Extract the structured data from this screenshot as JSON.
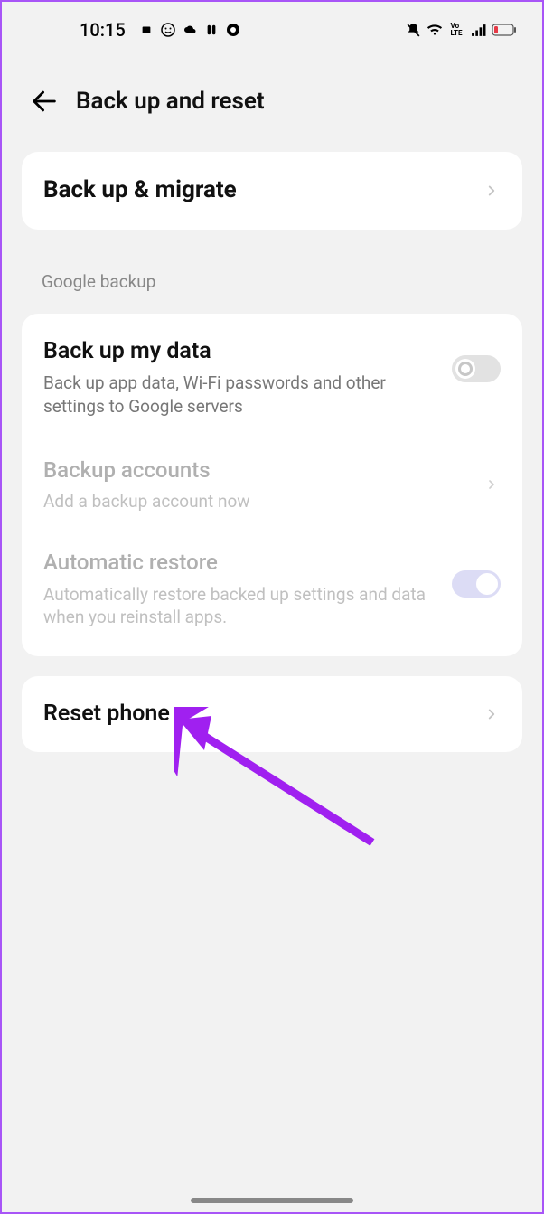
{
  "status_bar": {
    "time": "10:15"
  },
  "header": {
    "title": "Back up and reset"
  },
  "backup_migrate": {
    "label": "Back up & migrate"
  },
  "section_label": "Google backup",
  "backup_my_data": {
    "title": "Back up my data",
    "sub": "Back up app data, Wi-Fi passwords and other settings to Google servers",
    "enabled": false
  },
  "backup_accounts": {
    "title": "Backup accounts",
    "sub": "Add a backup account now"
  },
  "automatic_restore": {
    "title": "Automatic restore",
    "sub": "Automatically restore backed up settings and data when you reinstall apps.",
    "enabled": true
  },
  "reset_phone": {
    "label": "Reset phone"
  },
  "annotation": {
    "color": "#a020f0"
  }
}
